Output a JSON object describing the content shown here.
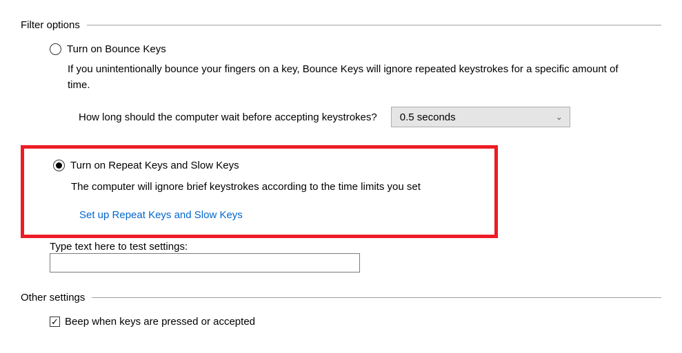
{
  "filterOptions": {
    "legend": "Filter options",
    "bounceKeys": {
      "label": "Turn on Bounce Keys",
      "selected": false,
      "description": "If you unintentionally bounce your fingers on a key, Bounce Keys will ignore repeated keystrokes for a specific amount of time.",
      "waitLabel": "How long should the computer wait before accepting keystrokes?",
      "waitValue": "0.5 seconds"
    },
    "repeatSlowKeys": {
      "label": "Turn on Repeat Keys and Slow Keys",
      "selected": true,
      "description": "The computer will ignore brief keystrokes according to the time limits you set",
      "setupLink": "Set up Repeat Keys and Slow Keys"
    },
    "test": {
      "label": "Type text here to test settings:",
      "value": ""
    }
  },
  "otherSettings": {
    "legend": "Other settings",
    "beep": {
      "label": "Beep when keys are pressed or accepted",
      "checked": true
    }
  }
}
